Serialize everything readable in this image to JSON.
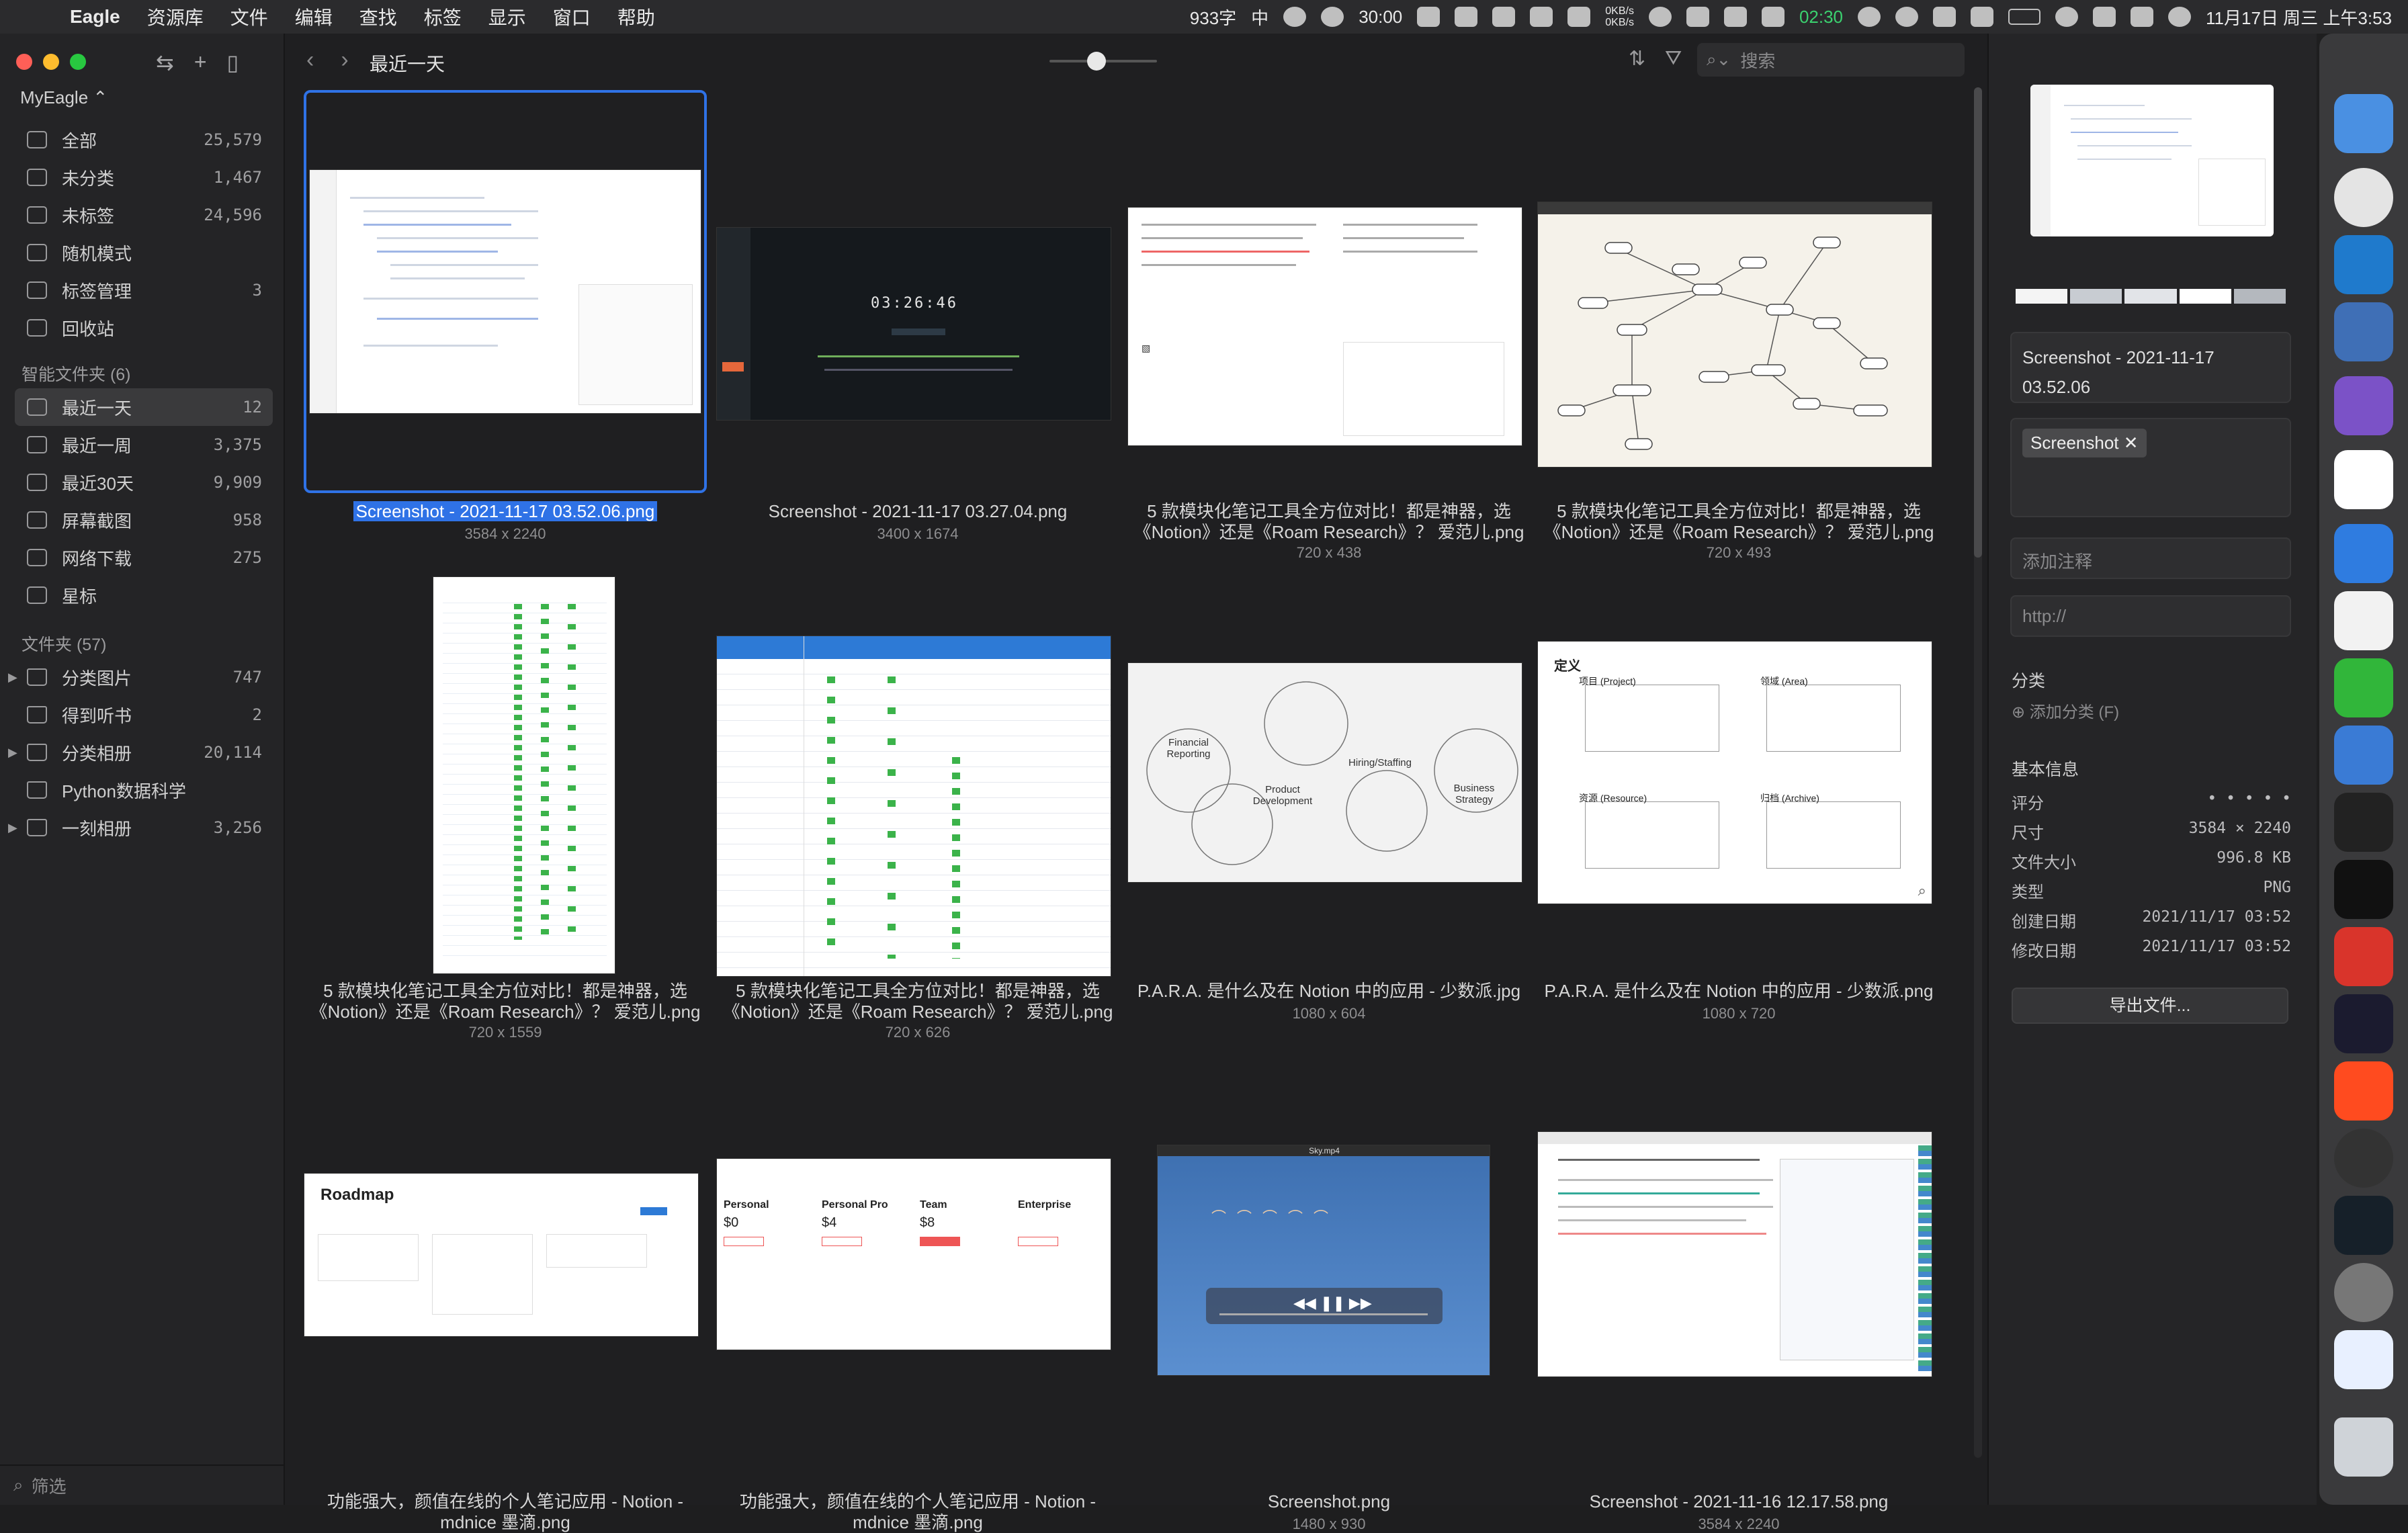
{
  "menubar": {
    "app_name": "Eagle",
    "menus": [
      "资源库",
      "文件",
      "编辑",
      "查找",
      "标签",
      "显示",
      "窗口",
      "帮助"
    ],
    "wordcount": "933字",
    "input_method": "中",
    "timer": "30:00",
    "timer2": "02:30",
    "net_up": "0KB/s",
    "net_down": "0KB/s",
    "datetime": "11月17日 周三 上午3:53"
  },
  "sidebar": {
    "library": "MyEagle ⌃",
    "items": [
      {
        "label": "全部",
        "count": "25,579"
      },
      {
        "label": "未分类",
        "count": "1,467"
      },
      {
        "label": "未标签",
        "count": "24,596"
      },
      {
        "label": "随机模式",
        "count": ""
      },
      {
        "label": "标签管理",
        "count": "3"
      },
      {
        "label": "回收站",
        "count": ""
      }
    ],
    "smart_header": "智能文件夹 (6)",
    "smart": [
      {
        "label": "最近一天",
        "count": "12"
      },
      {
        "label": "最近一周",
        "count": "3,375"
      },
      {
        "label": "最近30天",
        "count": "9,909"
      },
      {
        "label": "屏幕截图",
        "count": "958"
      },
      {
        "label": "网络下载",
        "count": "275"
      },
      {
        "label": "星标",
        "count": ""
      }
    ],
    "folder_header": "文件夹 (57)",
    "folders": [
      {
        "label": "分类图片",
        "count": "747"
      },
      {
        "label": "得到听书",
        "count": "2"
      },
      {
        "label": "分类相册",
        "count": "20,114"
      },
      {
        "label": "Python数据科学",
        "count": ""
      },
      {
        "label": "一刻相册",
        "count": "3,256"
      }
    ],
    "filter_placeholder": "筛选"
  },
  "toolbar": {
    "title": "最近一天",
    "search_placeholder": "搜索"
  },
  "items": [
    {
      "name": "Screenshot - 2021-11-17 03.52.06.png",
      "dim": "3584 x 2240"
    },
    {
      "name": "Screenshot - 2021-11-17 03.27.04.png",
      "dim": "3400 x 1674"
    },
    {
      "name": "5 款模块化笔记工具全方位对比！都是神器，选《Notion》还是《Roam Research》？ 爱范儿.png",
      "dim": "720 x 438"
    },
    {
      "name": "5 款模块化笔记工具全方位对比！都是神器，选《Notion》还是《Roam Research》？ 爱范儿.png",
      "dim": "720 x 493"
    },
    {
      "name": "5 款模块化笔记工具全方位对比！都是神器，选《Notion》还是《Roam Research》？ 爱范儿.png",
      "dim": "720 x 1559"
    },
    {
      "name": "5 款模块化笔记工具全方位对比！都是神器，选《Notion》还是《Roam Research》？ 爱范儿.png",
      "dim": "720 x 626"
    },
    {
      "name": "P.A.R.A. 是什么及在 Notion 中的应用 - 少数派.jpg",
      "dim": "1080 x 604"
    },
    {
      "name": "P.A.R.A. 是什么及在 Notion 中的应用 - 少数派.png",
      "dim": "1080 x 720"
    },
    {
      "name": "功能强大，颜值在线的个人笔记应用 - Notion - mdnice 墨滴.png",
      "dim": ""
    },
    {
      "name": "功能强大，颜值在线的个人笔记应用 - Notion - mdnice 墨滴.png",
      "dim": ""
    },
    {
      "name": "Screenshot.png",
      "dim": "1480 x 930"
    },
    {
      "name": "Screenshot - 2021-11-16 12.17.58.png",
      "dim": "3584 x 2240"
    }
  ],
  "thumbs": {
    "clock": "03:26:46",
    "roadmap_title": "Roadmap",
    "para_title": "定义",
    "para_boxes": [
      "项目 (Project)",
      "领域 (Area)",
      "资源 (Resource)",
      "归档 (Archive)"
    ],
    "para_circles": [
      "Financial Reporting",
      "Product Development",
      "Hiring/Staffing",
      "Business Strategy"
    ],
    "pricing_plans": [
      "Personal",
      "Personal Pro",
      "Team",
      "Enterprise"
    ],
    "pricing_prices": [
      "$0",
      "$4",
      "$8",
      ""
    ],
    "video_title": "Sky.mp4"
  },
  "inspector": {
    "name": "Screenshot - 2021-11-17 03.52.06",
    "tag": "Screenshot",
    "note_placeholder": "添加注释",
    "url_placeholder": "http://",
    "category_header": "分类",
    "add_category": "添加分类 (F)",
    "info_header": "基本信息",
    "info": [
      {
        "label": "评分",
        "value": "• • • • •"
      },
      {
        "label": "尺寸",
        "value": "3584 × 2240"
      },
      {
        "label": "文件大小",
        "value": "996.8 KB"
      },
      {
        "label": "类型",
        "value": "PNG"
      },
      {
        "label": "创建日期",
        "value": "2021/11/17 03:52"
      },
      {
        "label": "修改日期",
        "value": "2021/11/17 03:52"
      }
    ],
    "export": "导出文件..."
  },
  "colors": {
    "accent": "#2f72e6",
    "palette": [
      "#f4f4f4",
      "#c8ccd2",
      "#e2e4e8",
      "#ffffff",
      "#b4b8be"
    ]
  }
}
